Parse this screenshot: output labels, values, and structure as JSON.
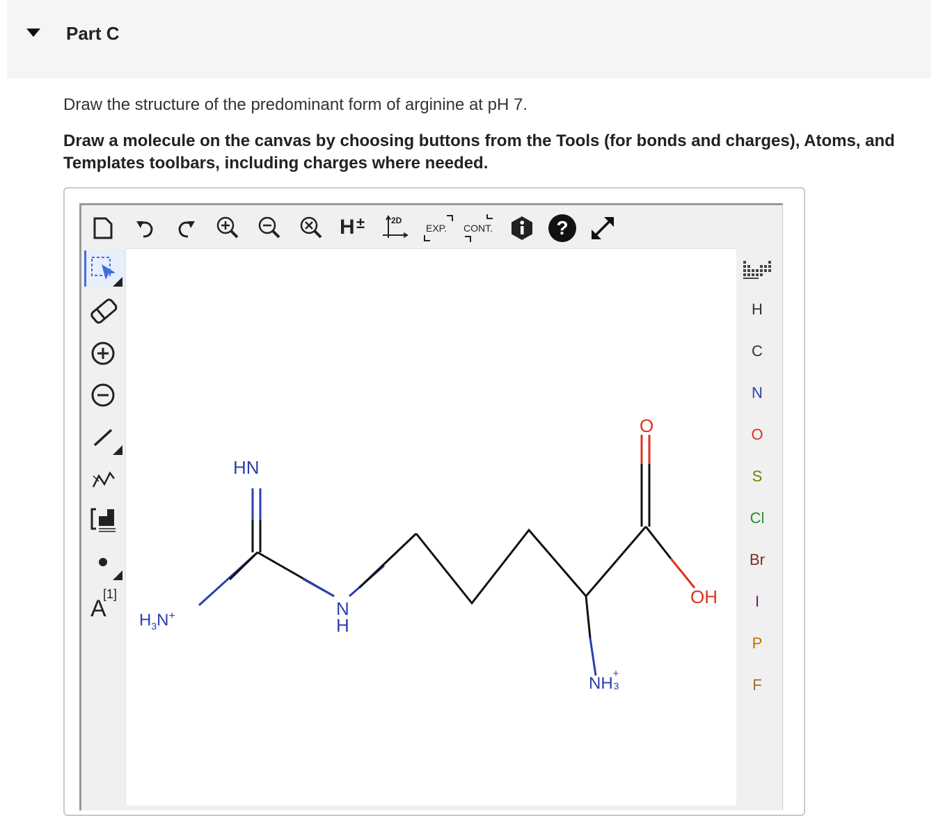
{
  "part": {
    "title": "Part C"
  },
  "question": "Draw the structure of the predominant form of arginine at pH 7.",
  "instruction": "Draw a molecule on the canvas by choosing buttons from the Tools (for bonds and charges), Atoms, and Templates toolbars, including charges where needed.",
  "top_toolbar": {
    "h_label": "H",
    "h_sign": "±",
    "two_d": "2D",
    "exp": "EXP.",
    "cont": "CONT."
  },
  "left_toolbar": {
    "label_tool": "A",
    "label_tool_sup": "[1]"
  },
  "atoms": [
    {
      "symbol": "H",
      "color": "#333333"
    },
    {
      "symbol": "C",
      "color": "#333333"
    },
    {
      "symbol": "N",
      "color": "#2b3fb0"
    },
    {
      "symbol": "O",
      "color": "#e0301e"
    },
    {
      "symbol": "S",
      "color": "#7a7a00"
    },
    {
      "symbol": "Cl",
      "color": "#2e8b2e"
    },
    {
      "symbol": "Br",
      "color": "#7a2d1e"
    },
    {
      "symbol": "I",
      "color": "#7a1e7a"
    },
    {
      "symbol": "P",
      "color": "#c07000"
    },
    {
      "symbol": "F",
      "color": "#a07020"
    }
  ],
  "molecule_labels": {
    "imine": "HN",
    "guanidinium": "H",
    "guanidinium_n": "N",
    "guanidinium_sub": "3",
    "guanidinium_charge": "+",
    "amide_n": "N",
    "amide_h": "H",
    "carbonyl_o": "O",
    "hydroxyl": "OH",
    "amine": "NH",
    "amine_sub": "3",
    "amine_charge": "+"
  }
}
